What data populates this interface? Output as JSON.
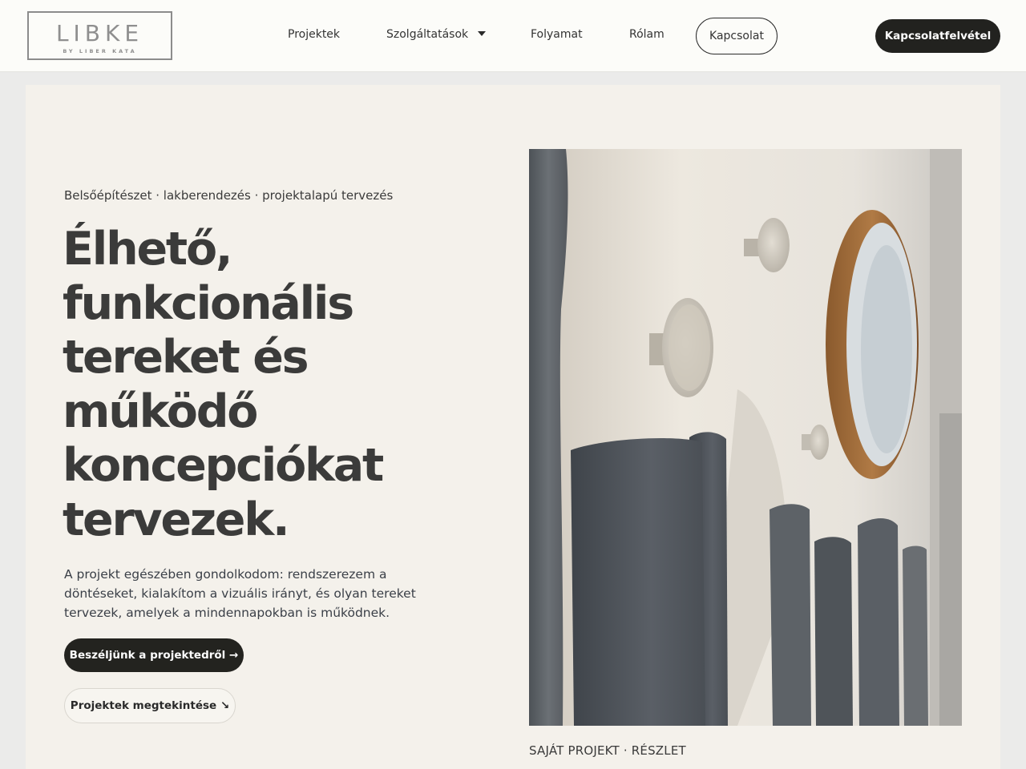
{
  "header": {
    "logo": {
      "main": "LIBKE",
      "sub": "BY LIBER KATA"
    },
    "nav": [
      {
        "label": "Projektek"
      },
      {
        "label": "Szolgáltatások",
        "has_dropdown": true
      },
      {
        "label": "Folyamat"
      },
      {
        "label": "Rólam"
      },
      {
        "label": "Kapcsolat",
        "style": "outlined"
      }
    ],
    "cta": "Kapcsolatfelvétel"
  },
  "hero": {
    "eyebrow": "Belsőépítészet · lakberendezés · projektalapú tervezés",
    "headline_lines": [
      "Élhető,",
      "funkcionális",
      "tereket és",
      "működő",
      "koncepciókat",
      "tervezek."
    ],
    "lead": "A projekt egészében gondolkodom: rendszerezem a döntéseket, kialakítom a vizuális irányt, és olyan tereket tervezek, amelyek a mindennapokban is működnek.",
    "primary_button": "Beszéljünk a projektedről →",
    "secondary_button": "Projektek megtekintése ↘",
    "image_caption": "SAJÁT PROJEKT · RÉSZLET"
  },
  "colors": {
    "page_bg": "#ebebea",
    "header_bg": "#fcfcf9",
    "hero_bg": "#f4f1eb",
    "dark_button": "#23231f",
    "headline": "#3b3b3a"
  },
  "icons": {
    "dropdown": "caret-down-icon"
  }
}
